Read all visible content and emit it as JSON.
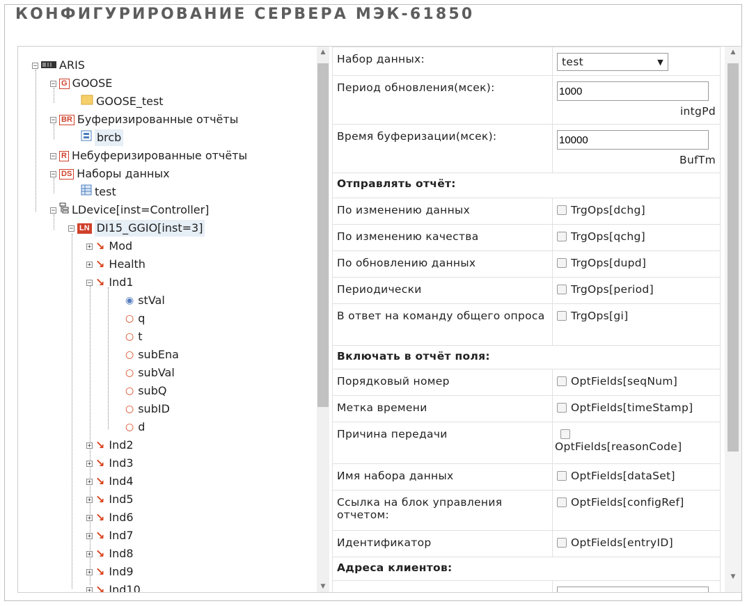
{
  "title": "КОНФИГУРИРОВАНИЕ СЕРВЕРА МЭК-61850",
  "tree": {
    "root": "ARIS",
    "goose": "GOOSE",
    "goose_child": "GOOSE_test",
    "br": "Буферизированные отчёты",
    "br_child": "brcb",
    "r": "Небуферизированные отчёты",
    "ds": "Наборы данных",
    "ds_child": "test",
    "ldevice": "LDevice[inst=Controller]",
    "ln": "DI15_GGIO[inst=3]",
    "nodes": [
      "Mod",
      "Health",
      "Ind1"
    ],
    "attrs": [
      "stVal",
      "q",
      "t",
      "subEna",
      "subVal",
      "subQ",
      "subID",
      "d"
    ],
    "more_nodes": [
      "Ind2",
      "Ind3",
      "Ind4",
      "Ind5",
      "Ind6",
      "Ind7",
      "Ind8",
      "Ind9",
      "Ind10"
    ],
    "badges": {
      "g": "G",
      "br": "BR",
      "r": "R",
      "ds": "DS",
      "ln": "LN"
    }
  },
  "props": {
    "dataset_label": "Набор данных:",
    "dataset_value": "test",
    "period_label": "Период обновления(мсек):",
    "period_value": "1000",
    "period_unit": "intgPd",
    "buf_label": "Время буферизации(мсек):",
    "buf_value": "10000",
    "buf_unit": "BufTm",
    "send_section": "Отправлять отчёт:",
    "triggers": [
      {
        "label": "По изменению данных",
        "opt": "TrgOps[dchg]"
      },
      {
        "label": "По изменению качества",
        "opt": "TrgOps[qchg]"
      },
      {
        "label": "По обновлению данных",
        "opt": "TrgOps[dupd]"
      },
      {
        "label": "Периодически",
        "opt": "TrgOps[period]"
      },
      {
        "label": "В ответ на команду общего опроса",
        "opt": "TrgOps[gi]"
      }
    ],
    "fields_section": "Включать в отчёт поля:",
    "fields": [
      {
        "label": "Порядковый номер",
        "opt": "OptFields[seqNum]"
      },
      {
        "label": "Метка времени",
        "opt": "OptFields[timeStamp]"
      },
      {
        "label": "Причина передачи",
        "opt": "OptFields[reasonCode]"
      },
      {
        "label": "Имя набора данных",
        "opt": "OptFields[dataSet]"
      },
      {
        "label": "Ссылка на блок управления отчетом:",
        "opt": "OptFields[configRef]"
      },
      {
        "label": "Идентификатор",
        "opt": "OptFields[entryID]"
      }
    ],
    "clients_section": "Адреса клиентов:"
  }
}
